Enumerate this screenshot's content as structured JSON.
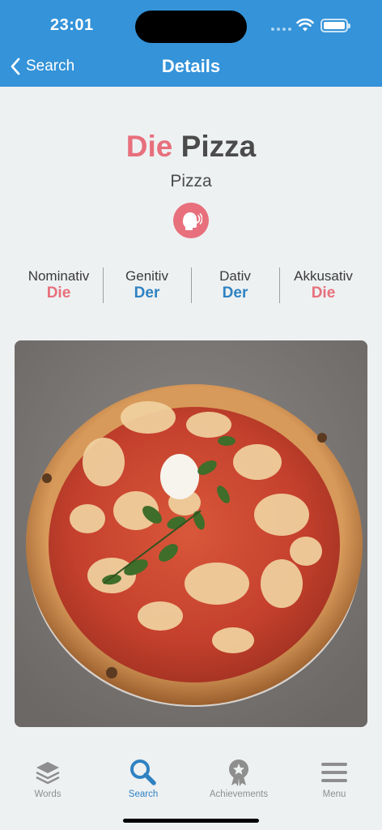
{
  "status_bar": {
    "time": "23:01"
  },
  "nav": {
    "back_label": "Search",
    "title": "Details"
  },
  "word": {
    "article": "Die",
    "noun": "Pizza",
    "translation": "Pizza"
  },
  "speak": {
    "icon": "speaker-head-icon"
  },
  "cases": [
    {
      "name": "Nominativ",
      "article": "Die",
      "color": "#e7707c"
    },
    {
      "name": "Genitiv",
      "article": "Der",
      "color": "#2f82c2"
    },
    {
      "name": "Dativ",
      "article": "Der",
      "color": "#2f82c2"
    },
    {
      "name": "Akkusativ",
      "article": "Die",
      "color": "#e7707c"
    }
  ],
  "tabs": [
    {
      "label": "Words",
      "icon": "layers-icon",
      "active": false
    },
    {
      "label": "Search",
      "icon": "search-icon",
      "active": true
    },
    {
      "label": "Achievements",
      "icon": "medal-icon",
      "active": false
    },
    {
      "label": "Menu",
      "icon": "menu-icon",
      "active": false
    }
  ],
  "colors": {
    "header": "#3493d9",
    "article_red": "#e7707c",
    "article_blue": "#2f82c2",
    "active_tab": "#2f82c2"
  }
}
